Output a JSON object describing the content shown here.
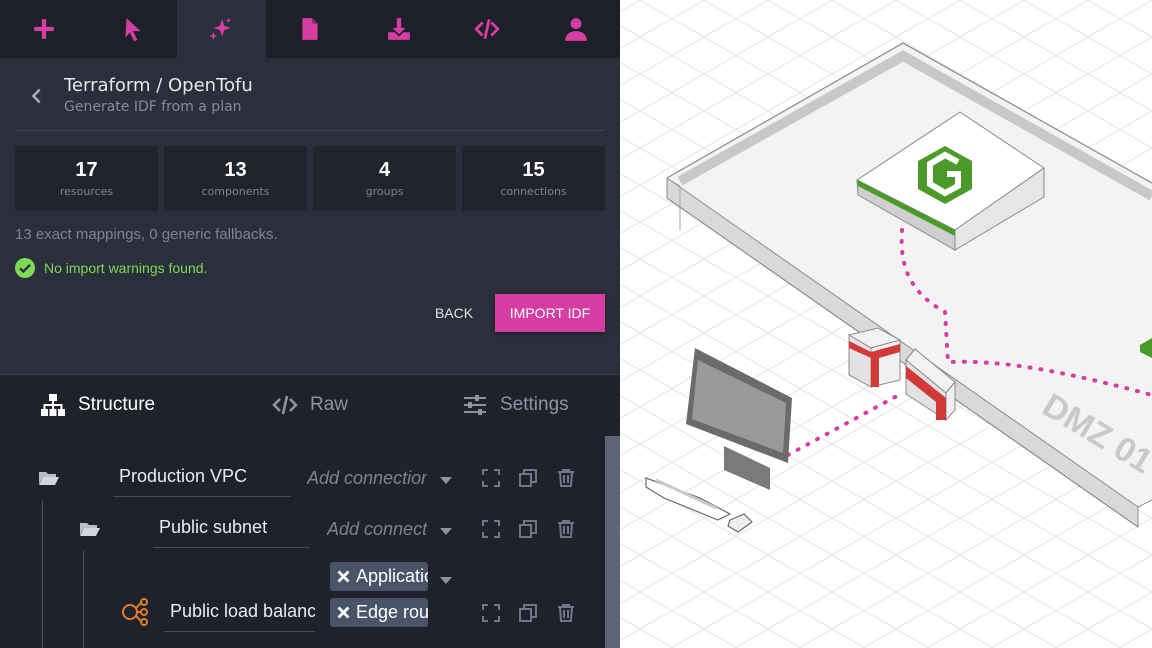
{
  "toolbar": {
    "items": [
      {
        "icon": "plus-icon"
      },
      {
        "icon": "cursor-icon"
      },
      {
        "icon": "sparkle-icon",
        "active": true
      },
      {
        "icon": "document-icon"
      },
      {
        "icon": "download-icon"
      },
      {
        "icon": "code-icon"
      },
      {
        "icon": "user-icon"
      }
    ],
    "accent_color": "#d63da3"
  },
  "import": {
    "title": "Terraform / OpenTofu",
    "subtitle": "Generate IDF from a plan",
    "stats": [
      {
        "value": "17",
        "label": "resources"
      },
      {
        "value": "13",
        "label": "components"
      },
      {
        "value": "4",
        "label": "groups"
      },
      {
        "value": "15",
        "label": "connections"
      }
    ],
    "mapping_note": "13 exact mappings, 0 generic fallbacks.",
    "warnings_text": "No import warnings found.",
    "back_label": "BACK",
    "import_label": "IMPORT IDF",
    "success_color": "#7ed957"
  },
  "tabs": [
    {
      "label": "Structure",
      "icon": "sitemap-icon",
      "active": true
    },
    {
      "label": "Raw",
      "icon": "code-icon",
      "active": false
    },
    {
      "label": "Settings",
      "icon": "sliders-icon",
      "active": false
    }
  ],
  "tree": {
    "rows": [
      {
        "name": "Production VPC",
        "icon": "folder-open-icon",
        "connection_placeholder": "Add connection"
      },
      {
        "name": "Public subnet",
        "icon": "folder-open-icon",
        "connection_placeholder": "Add connection"
      },
      {
        "name": "Public load balancer",
        "icon": "load-balancer-icon",
        "chips": [
          "Application",
          "Edge router"
        ]
      }
    ]
  },
  "diagram": {
    "zone_label": "DMZ 01",
    "connection_color": "#d63da3"
  }
}
